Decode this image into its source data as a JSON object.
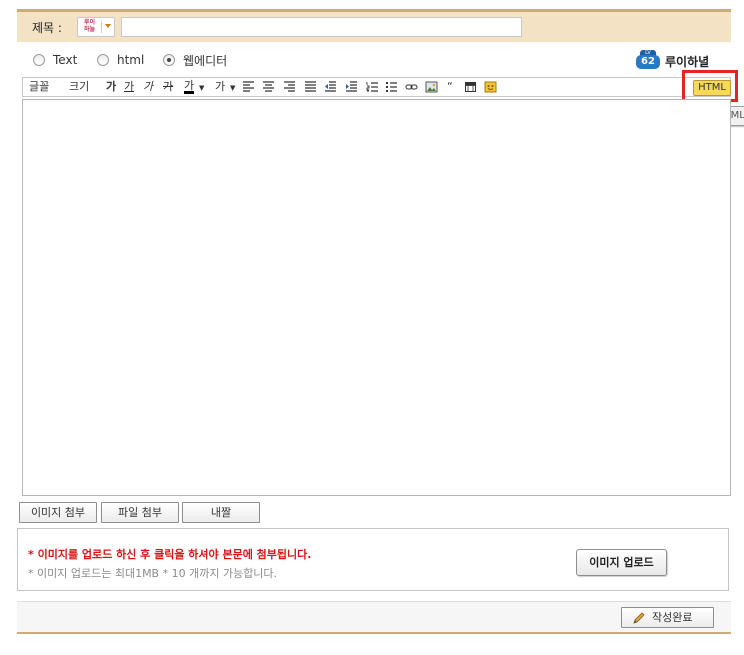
{
  "title_bar": {
    "label": "제목 :",
    "category_logo": "루이\n하늘",
    "title_value": "",
    "title_placeholder": ""
  },
  "mode": {
    "options": [
      {
        "label": "Text",
        "checked": false
      },
      {
        "label": "html",
        "checked": false
      },
      {
        "label": "웹에디터",
        "checked": true
      }
    ],
    "level_label": "LV",
    "level": "62",
    "nickname": "루이하녈"
  },
  "toolbar": {
    "font_label": "글꼴",
    "size_label": "크기",
    "bold_label": "가",
    "underline_label": "가",
    "italic_label": "가",
    "strike_label": "가",
    "fontcolor_label": "가",
    "bgcolor_label": "가",
    "html_label": "HTML",
    "tooltip": "HTML"
  },
  "editor": {
    "content": ""
  },
  "attach": {
    "image_label": "이미지 첨부",
    "file_label": "파일 첨부",
    "my_drive_label": "내짤"
  },
  "upload": {
    "notice": "* 이미지를 업로드 하신 후 클릭을 하셔야 본문에 첨부됩니다.",
    "limit": "* 이미지 업로드는 최대1MB * 10 개까지 가능합니다.",
    "button_label": "이미지 업로드"
  },
  "footer": {
    "submit_label": "작성완료"
  },
  "colors": {
    "accent_border": "#c9ab7d",
    "title_bg": "#f3e2c4",
    "highlight": "#e52525",
    "html_button": "#f7d85a",
    "notice_red": "#d81414",
    "level_blue": "#2a77c5"
  }
}
